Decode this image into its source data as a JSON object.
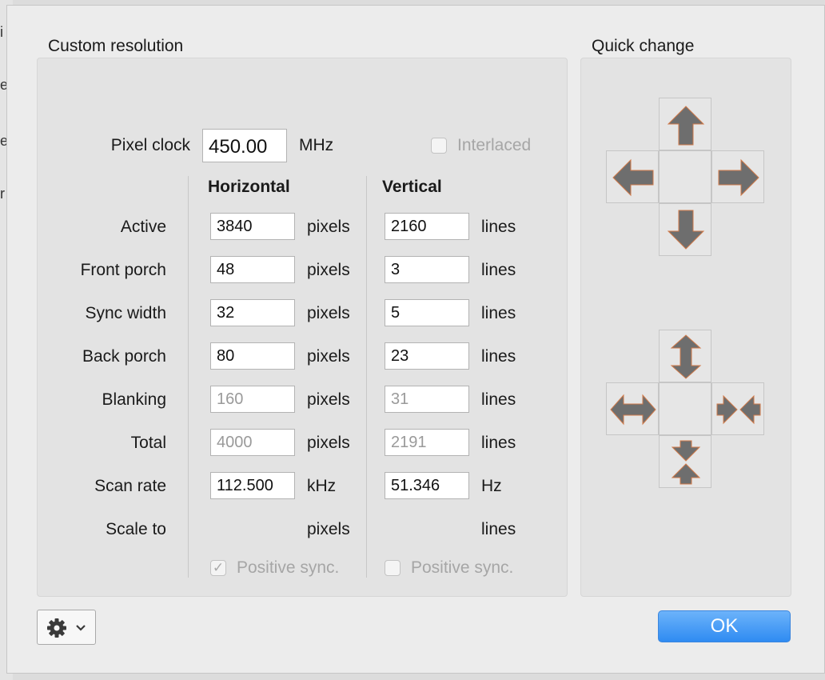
{
  "sections": {
    "custom_title": "Custom resolution",
    "quick_title": "Quick change"
  },
  "pixel_clock": {
    "label": "Pixel clock",
    "value": "450.00",
    "unit": "MHz"
  },
  "interlaced": {
    "label": "Interlaced",
    "checked": false
  },
  "columns": {
    "horizontal": "Horizontal",
    "vertical": "Vertical"
  },
  "rows": [
    {
      "label": "Active",
      "h_value": "3840",
      "h_unit": "pixels",
      "v_value": "2160",
      "v_unit": "lines",
      "editable": true
    },
    {
      "label": "Front porch",
      "h_value": "48",
      "h_unit": "pixels",
      "v_value": "3",
      "v_unit": "lines",
      "editable": true
    },
    {
      "label": "Sync width",
      "h_value": "32",
      "h_unit": "pixels",
      "v_value": "5",
      "v_unit": "lines",
      "editable": true
    },
    {
      "label": "Back porch",
      "h_value": "80",
      "h_unit": "pixels",
      "v_value": "23",
      "v_unit": "lines",
      "editable": true
    },
    {
      "label": "Blanking",
      "h_value": "160",
      "h_unit": "pixels",
      "v_value": "31",
      "v_unit": "lines",
      "editable": false
    },
    {
      "label": "Total",
      "h_value": "4000",
      "h_unit": "pixels",
      "v_value": "2191",
      "v_unit": "lines",
      "editable": false
    },
    {
      "label": "Scan rate",
      "h_value": "112.500",
      "h_unit": "kHz",
      "v_value": "51.346",
      "v_unit": "Hz",
      "editable": true
    },
    {
      "label": "Scale to",
      "h_value": "",
      "h_unit": "pixels",
      "v_value": "",
      "v_unit": "lines",
      "editable": false
    }
  ],
  "h_sync": {
    "label": "Positive sync.",
    "checked": true,
    "check_glyph": "✓"
  },
  "v_sync": {
    "label": "Positive sync.",
    "checked": false
  },
  "quick_change": {
    "move_icons": [
      "arrow-up-icon",
      "arrow-left-icon",
      "arrow-right-icon",
      "arrow-down-icon"
    ],
    "resize_icons": [
      "expand-vertical-icon",
      "expand-horizontal-icon",
      "shrink-horizontal-icon",
      "shrink-vertical-icon"
    ]
  },
  "footer": {
    "gear_icon": "gear-icon",
    "chevron_icon": "chevron-down-icon",
    "ok_label": "OK"
  },
  "colors": {
    "accent": "#2f8bf2",
    "arrow": "#6e6e6e"
  },
  "background_fragments": [
    "i",
    "e",
    "e",
    "r"
  ]
}
